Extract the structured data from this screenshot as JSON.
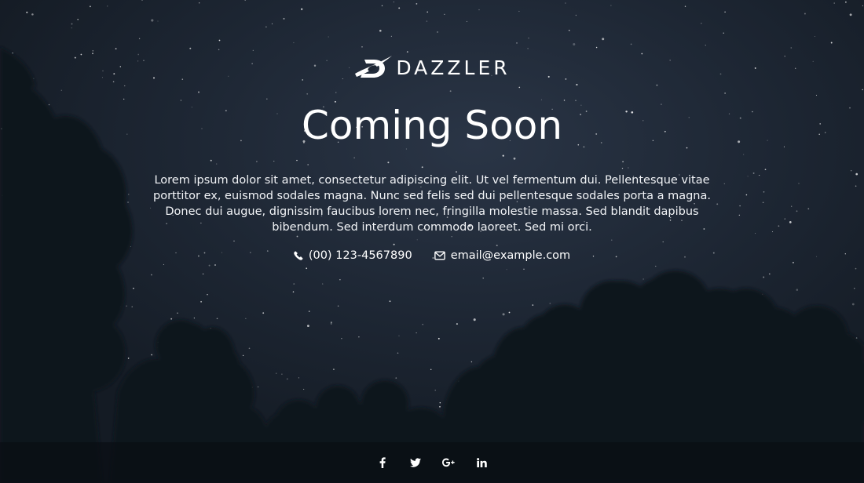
{
  "brand": {
    "name": "DAZZLER",
    "logo_icon": "dazzler-logo-icon"
  },
  "hero": {
    "title": "Coming Soon",
    "description": "Lorem ipsum dolor sit amet, consectetur adipiscing elit. Ut vel fermentum dui. Pellentesque vitae porttitor ex, euismod sodales magna. Nunc sed felis sed dui pellentesque sodales porta a magna. Donec dui augue, dignissim faucibus lorem nec, fringilla molestie massa. Sed blandit dapibus bibendum. Sed interdum commodo laoreet. Sed mi orci."
  },
  "contacts": {
    "phone": {
      "icon": "phone-icon",
      "text": "(00) 123-4567890"
    },
    "email": {
      "icon": "envelope-icon",
      "text": "email@example.com"
    }
  },
  "footer": {
    "social": [
      {
        "name": "facebook",
        "icon": "facebook-icon"
      },
      {
        "name": "twitter",
        "icon": "twitter-icon"
      },
      {
        "name": "google-plus",
        "icon": "google-plus-icon"
      },
      {
        "name": "linkedin",
        "icon": "linkedin-icon"
      }
    ]
  },
  "colors": {
    "sky_center": "#2a3546",
    "sky_edge": "#141b24",
    "tree": "#0f151c",
    "footer_bg": "#0a0e13",
    "text": "#ffffff"
  }
}
